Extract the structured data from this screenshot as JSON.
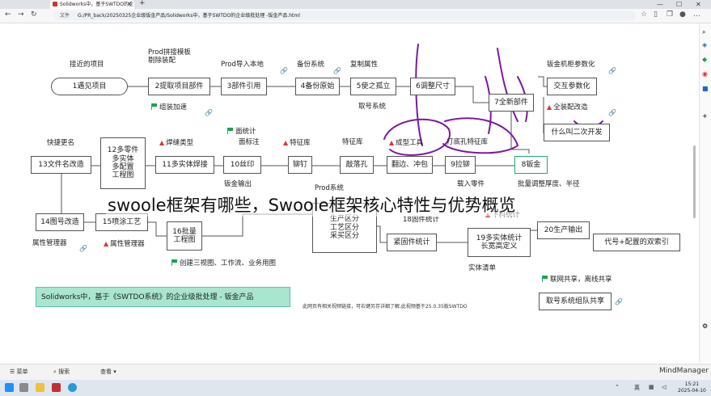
{
  "browser": {
    "tab_title": "Solidworks中，基于SWTDO的企",
    "address_label": "文件",
    "url": "G:/PR_back/20250325企业级钣金产品/Solidworks中，基于SWTDO的企业级批处理 -钣金产品.html"
  },
  "mindmap": {
    "top_labels": {
      "recent": "接近的项目",
      "prod_template": "Prod拼接模板\n剔除装配",
      "prod_import": "Prod导入本地",
      "backup_system": "备份系统",
      "copy_property": "复制属性",
      "sheetmetal_cabinet": "钣金机柜参数化"
    },
    "nodes": {
      "n1": "1遇见项目",
      "n2": "2提取项目部件",
      "n3": "3部件引用",
      "n4": "4备份原始",
      "n5": "5使之孤立",
      "n6": "6调整尺寸",
      "n7": "7全新部件",
      "n8": "8钣金",
      "n9": "9拉铆",
      "n10": "10丝印",
      "n11": "11多实体焊接",
      "n12": "12多零件\n多实体\n多配置\n工程图",
      "n13": "13文件名改造",
      "n14": "14图号改造",
      "n15": "15喷涂工艺",
      "n16": "16批量\n工程图",
      "n17": "生产区分\n工艺区分\n采买区分",
      "n18": "紧固件统计",
      "n19": "19多实体统计\n长宽高定义",
      "n20": "20生产输出",
      "interactive_param": "交互参数化",
      "double_open": "什么叫二次开发",
      "dual_display": "代号+配置的双索引",
      "fetch_share": "取号系统组队共享",
      "riveting": "铆钉",
      "stamping": "敲落孔",
      "flanging": "翻边、冲包"
    },
    "labels": {
      "assembly_accel": "组装加速",
      "full_config": "全装配改造",
      "fetch_number": "取号系统",
      "face_stats": "面统计",
      "face_annotation": "面标注",
      "weld_type": "焊缝类型",
      "feature_lib": "特征库",
      "feature_lib2": "特征库",
      "forming_tool": "成型工具",
      "punch_feature_lib": "打底孔特征库",
      "quick_rename": "快捷更名",
      "sheetmetal_output": "钣金输出",
      "prod_system": "Prod系统",
      "batch_adjust": "批量调整厚度、半径",
      "load_parts": "载入零件",
      "fastener_stats": "18固件统计",
      "blanking_stats": "下料统计",
      "attr_manager1": "属性管理器",
      "attr_manager2": "属性管理器",
      "create_views": "创建三视图、工作流、业务用图",
      "entity_list": "实体清单",
      "networking": "联网共享，离线共享"
    },
    "banner": "Solidworks中，基于《SWTDO系统》的企业级批处理 - 钣金产品",
    "footer_note_1": "此网页有相关视频链接，可右键另存详细了解,此视频基于25.0.35版SWTDO",
    "footer_note_2": ""
  },
  "overlay_caption": "swoole框架有哪些，Swoole框架核心特性与优势概览",
  "bottom_bar": {
    "menu": "菜单",
    "search": "搜索",
    "view": "查看",
    "brand": "MindManager"
  },
  "taskbar": {
    "lang": "英",
    "time": "15:21",
    "date": "2025-04-10"
  }
}
